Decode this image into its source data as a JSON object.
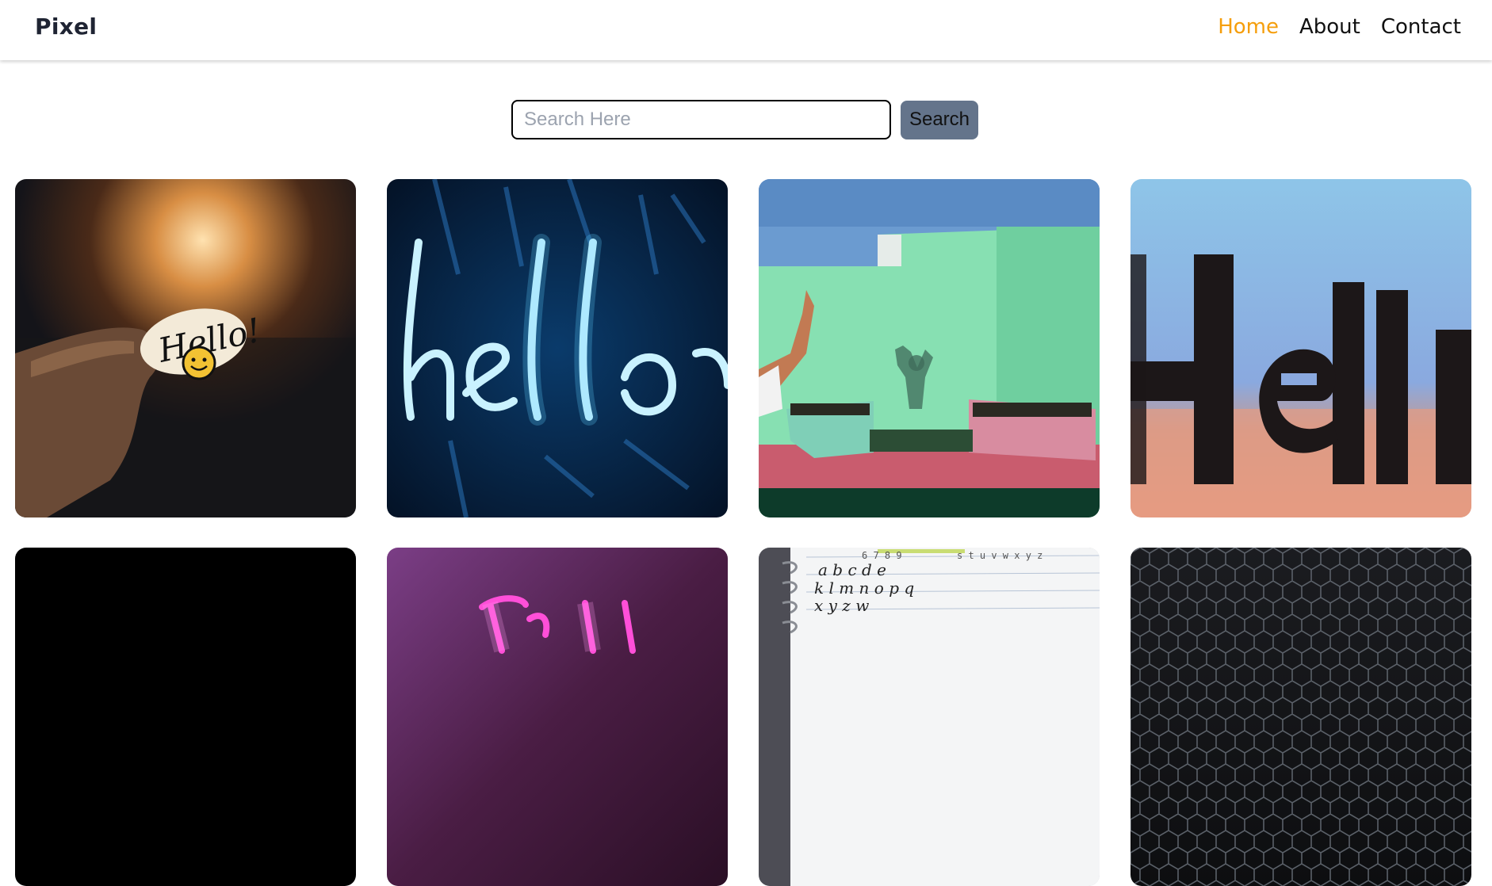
{
  "navbar": {
    "logo": "Pixel",
    "links": [
      {
        "label": "Home",
        "active": true
      },
      {
        "label": "About",
        "active": false
      },
      {
        "label": "Contact",
        "active": false
      }
    ]
  },
  "search": {
    "placeholder": "Search Here",
    "value": "",
    "button_label": "Search"
  },
  "gallery": {
    "images": [
      {
        "subject": "hand holding hello sticker"
      },
      {
        "subject": "blue neon hello sign"
      },
      {
        "subject": "person waving at green wall"
      },
      {
        "subject": "blurred Hello letters"
      },
      {
        "subject": "black image"
      },
      {
        "subject": "pink neon sign"
      },
      {
        "subject": "handwriting alphabet notebook"
      },
      {
        "subject": "dark hexagon mesh"
      }
    ]
  },
  "colors": {
    "accent": "#f59e0b",
    "button": "#64748b",
    "text": "#111111",
    "logo": "#1f2433"
  }
}
